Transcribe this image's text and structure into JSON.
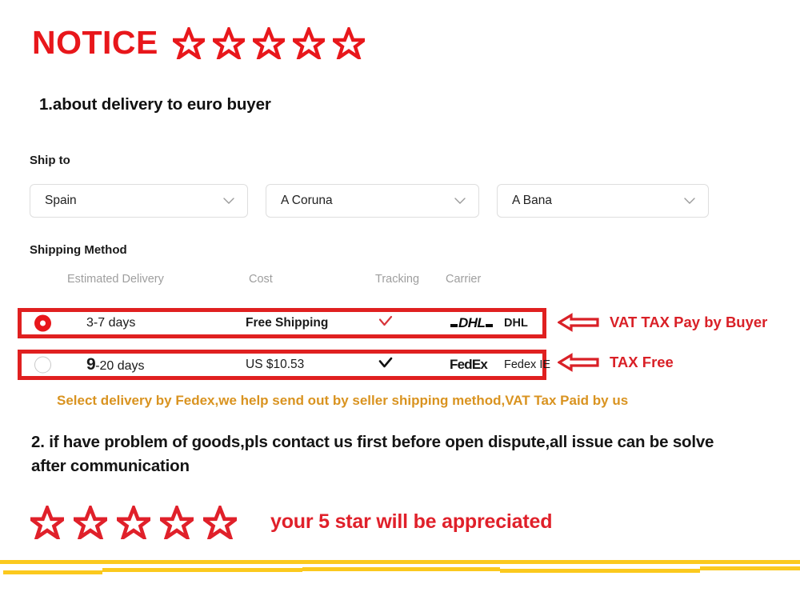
{
  "header": {
    "title": "NOTICE",
    "star_count": 5,
    "title_color": "#e8171b"
  },
  "section_1": {
    "heading": "1.about delivery to euro buyer"
  },
  "ship_to": {
    "label": "Ship to",
    "selects": [
      {
        "name": "country",
        "value": "Spain"
      },
      {
        "name": "province",
        "value": "A Coruna"
      },
      {
        "name": "city",
        "value": "A Bana"
      }
    ]
  },
  "shipping_method": {
    "label": "Shipping Method",
    "columns": [
      "Estimated Delivery",
      "Cost",
      "Tracking",
      "Carrier"
    ],
    "rows": [
      {
        "selected": true,
        "delivery": "3-7 days",
        "cost": "Free Shipping",
        "tracking": "check",
        "tracking_color": "#d8353b",
        "carrier_logo": "DHL",
        "carrier_name": "DHL",
        "annotation": "VAT TAX Pay by Buyer"
      },
      {
        "selected": false,
        "delivery_lead": "9",
        "delivery_rest": "-20 days",
        "cost": "US $10.53",
        "tracking": "check",
        "tracking_color": "#111111",
        "carrier_logo": "FedEx",
        "carrier_name": "Fedex IE",
        "annotation": "TAX Free"
      }
    ]
  },
  "notes": {
    "orange_note": "Select delivery by Fedex,we help send out by seller shipping method,VAT Tax Paid by us",
    "orange_color": "#d99320",
    "section_2": "2. if have problem of goods,pls contact us first before open dispute,all issue can be solve after communication"
  },
  "footer": {
    "star_count": 5,
    "message": "your 5 star will be appreciated",
    "message_color": "#e0202a",
    "bar_color": "#fbc91e"
  }
}
